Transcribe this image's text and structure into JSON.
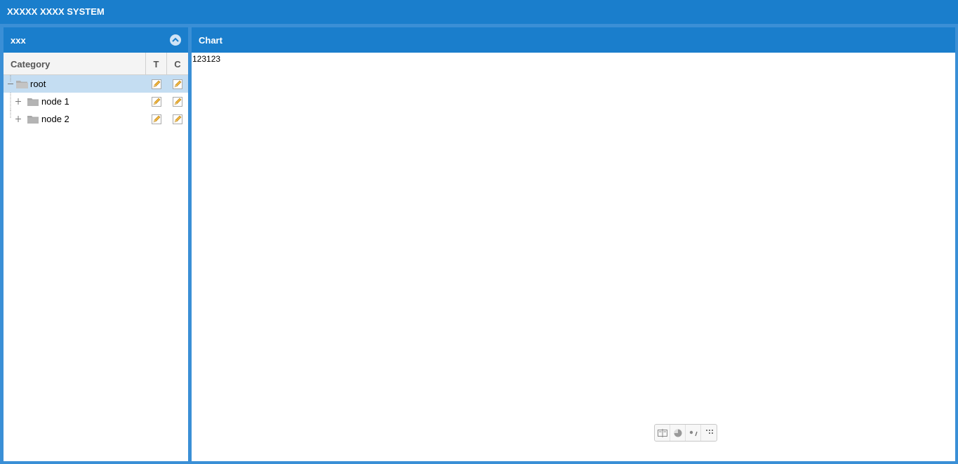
{
  "app": {
    "title": "XXXXX XXXX SYSTEM"
  },
  "left_panel": {
    "title": "xxx",
    "columns": {
      "category": "Category",
      "t": "T",
      "c": "C"
    },
    "rows": [
      {
        "label": "root",
        "level": 0,
        "selected": true
      },
      {
        "label": "node 1",
        "level": 1,
        "selected": false
      },
      {
        "label": "node 2",
        "level": 1,
        "selected": false
      }
    ]
  },
  "right_panel": {
    "title": "Chart",
    "content_text": "123123"
  },
  "toolbox": {
    "tools": [
      "data-view-icon",
      "pie-chart-icon",
      "scatter-icon",
      "restore-icon"
    ]
  },
  "colors": {
    "header_blue": "#1a7ecc",
    "frame_blue": "#3a8fd6",
    "selected_row": "#c4ddf2"
  }
}
